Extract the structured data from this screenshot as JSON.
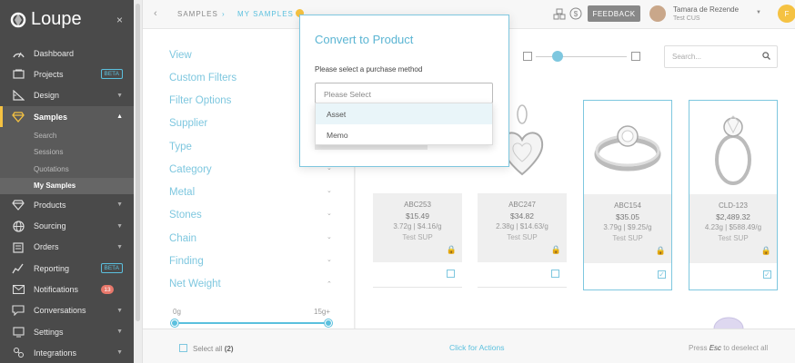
{
  "sidebar": {
    "logo": "Loupe",
    "close_icon": "×",
    "items": [
      {
        "label": "Dashboard",
        "icon": "dashboard-icon"
      },
      {
        "label": "Projects",
        "icon": "projects-icon",
        "badge": "BETA"
      },
      {
        "label": "Design",
        "icon": "design-icon",
        "caret": "▼"
      },
      {
        "label": "Samples",
        "icon": "diamond-icon",
        "caret": "▲"
      },
      {
        "label": "Products",
        "icon": "diamond-icon",
        "caret": "▼"
      },
      {
        "label": "Sourcing",
        "icon": "globe-icon",
        "caret": "▼"
      },
      {
        "label": "Orders",
        "icon": "clipboard-icon",
        "caret": "▼"
      },
      {
        "label": "Reporting",
        "icon": "chart-icon",
        "badge": "BETA"
      },
      {
        "label": "Notifications",
        "icon": "envelope-icon",
        "count": "13"
      },
      {
        "label": "Conversations",
        "icon": "chat-icon",
        "caret": "▼"
      },
      {
        "label": "Settings",
        "icon": "gear-icon",
        "caret": "▼"
      },
      {
        "label": "Integrations",
        "icon": "integrations-icon",
        "caret": "▼"
      }
    ],
    "samples_sub": [
      "Search",
      "Sessions",
      "Quotations",
      "My Samples"
    ]
  },
  "topbar": {
    "back": "‹",
    "crumb1": "SAMPLES",
    "crumb_sep": "›",
    "crumb2": "MY SAMPLES",
    "feedback": "FEEDBACK",
    "user_name": "Tamara de Rezende",
    "user_org": "Test CUS",
    "user_caret": "▼",
    "badge": "F"
  },
  "filters": {
    "items": [
      "View",
      "Custom Filters",
      "Filter Options",
      "Supplier",
      "Type",
      "Category",
      "Metal",
      "Stones",
      "Chain",
      "Finding",
      "Net Weight"
    ],
    "caret_down": "⌄",
    "caret_up": "⌃",
    "net_weight": {
      "min": "0g",
      "max": "15g+"
    }
  },
  "toolbar": {
    "search_placeholder": "Search..."
  },
  "cards": [
    {
      "code": "ABC253",
      "price": "$15.49",
      "weight": "3.72g | $4.16/g",
      "supplier": "Test SUP",
      "selected": false
    },
    {
      "code": "ABC247",
      "price": "$34.82",
      "weight": "2.38g | $14.63/g",
      "supplier": "Test SUP",
      "selected": false
    },
    {
      "code": "ABC154",
      "price": "$35.05",
      "weight": "3.79g | $9.25/g",
      "supplier": "Test SUP",
      "selected": true
    },
    {
      "code": "CLD-123",
      "price": "$2,489.32",
      "weight": "4.23g | $588.49/g",
      "supplier": "Test SUP",
      "selected": true
    }
  ],
  "bottombar": {
    "select_all": "Select all",
    "select_count": "(2)",
    "actions": "Click for Actions",
    "esc_prefix": "Press",
    "esc_key": "Esc",
    "esc_suffix": "to deselect all"
  },
  "modal": {
    "title": "Convert to Product",
    "subtitle": "Please select a purchase method",
    "placeholder": "Please Select",
    "options": [
      "Asset",
      "Memo"
    ]
  },
  "colors": {
    "accent": "#5bc0de",
    "sidebar": "#4a4a4a",
    "highlight": "#f5c242"
  }
}
